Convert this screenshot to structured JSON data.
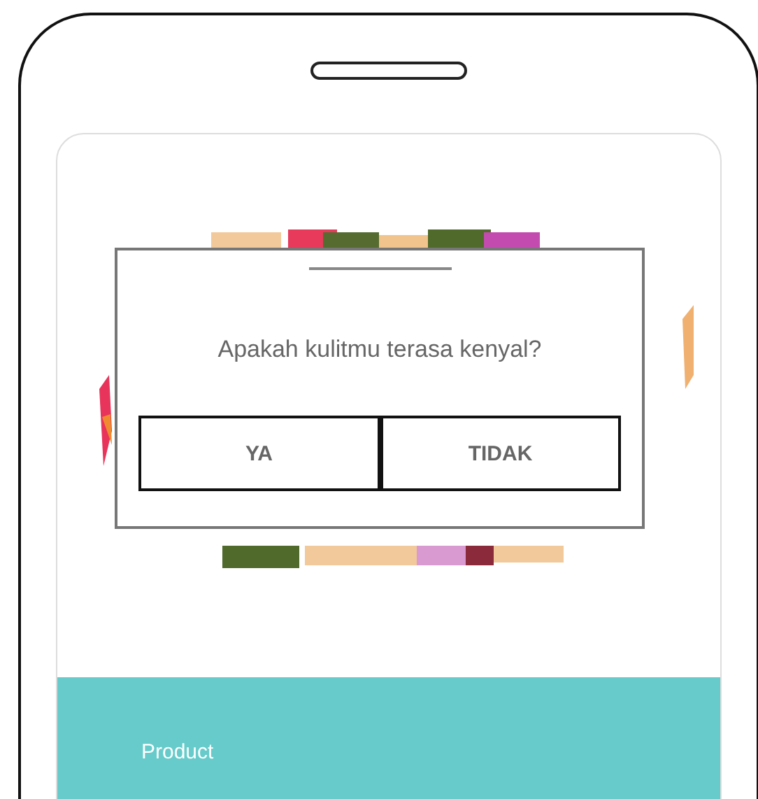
{
  "quiz": {
    "question": "Apakah kulitmu terasa kenyal?",
    "options": [
      {
        "label": "YA"
      },
      {
        "label": "TIDAK"
      }
    ]
  },
  "footer": {
    "label": "Product"
  }
}
